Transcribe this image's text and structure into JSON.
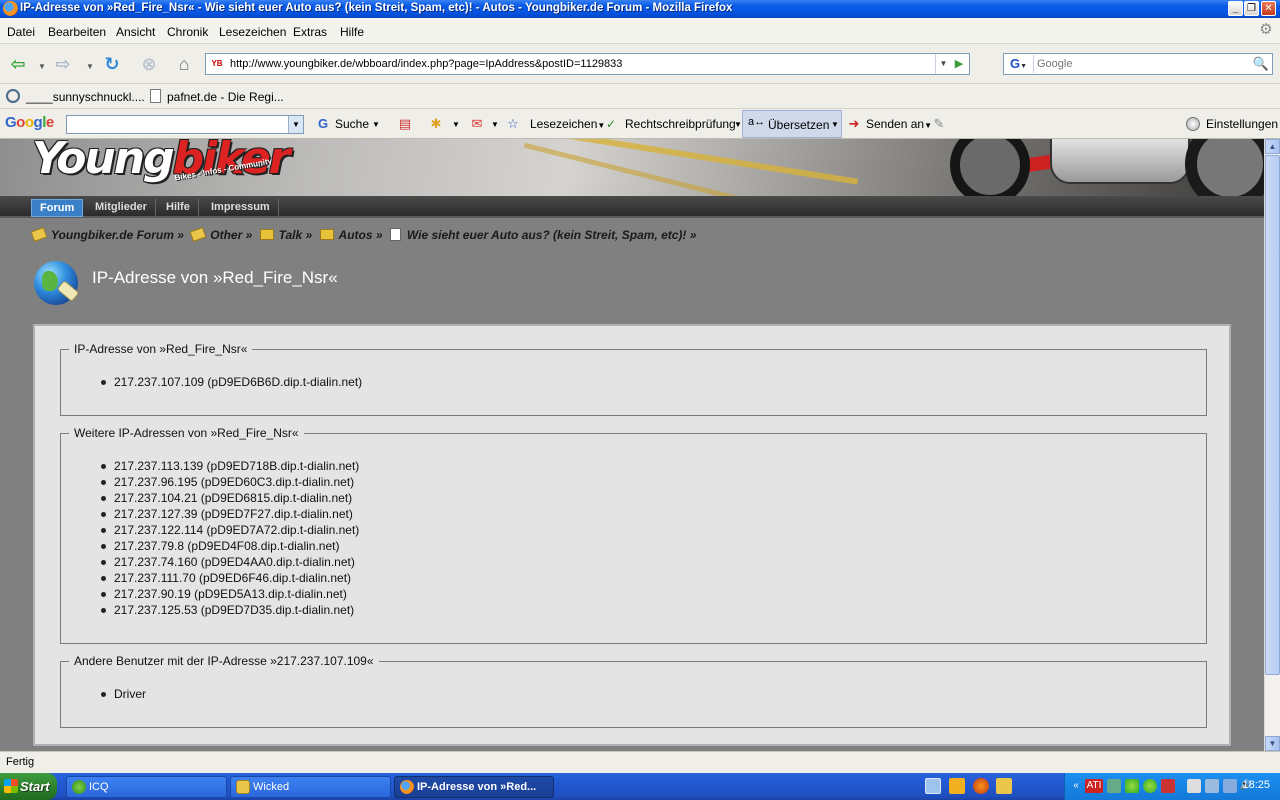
{
  "window": {
    "title": "IP-Adresse von »Red_Fire_Nsr« - Wie sieht euer Auto aus? (kein Streit, Spam, etc)! - Autos - Youngbiker.de Forum - Mozilla Firefox"
  },
  "menu": {
    "items": [
      "Datei",
      "Bearbeiten",
      "Ansicht",
      "Chronik",
      "Lesezeichen",
      "Extras",
      "Hilfe"
    ]
  },
  "navbar": {
    "url": "http://www.youngbiker.de/wbboard/index.php?page=IpAddress&postID=1129833",
    "search_value": "Google"
  },
  "bookmarks": {
    "items": [
      "____sunnyschnuckl....",
      "pafnet.de - Die Regi..."
    ]
  },
  "google_toolbar": {
    "logo": "Google",
    "search_label": "Suche",
    "bookmarks_label": "Lesezeichen",
    "spellcheck_label": "Rechtschreibprüfung",
    "translate_label": "Übersetzen",
    "send_label": "Senden an",
    "settings_label": "Einstellungen"
  },
  "site": {
    "logo_white": "Young",
    "logo_red": "biker",
    "slogan": "Bikes - Infos - Community",
    "tabs": [
      "Forum",
      "Mitglieder",
      "Hilfe",
      "Impressum"
    ]
  },
  "breadcrumb": [
    "Youngbiker.de Forum »",
    "Other »",
    "Talk »",
    "Autos »",
    "Wie sieht euer Auto aus? (kein Streit, Spam, etc)! »"
  ],
  "page": {
    "title": "IP-Adresse von »Red_Fire_Nsr«"
  },
  "sections": {
    "ip": {
      "legend": "IP-Adresse von »Red_Fire_Nsr«",
      "items": [
        "217.237.107.109 (pD9ED6B6D.dip.t-dialin.net)"
      ]
    },
    "other_ips": {
      "legend": "Weitere IP-Adressen von »Red_Fire_Nsr«",
      "items": [
        "217.237.113.139 (pD9ED718B.dip.t-dialin.net)",
        "217.237.96.195 (pD9ED60C3.dip.t-dialin.net)",
        "217.237.104.21 (pD9ED6815.dip.t-dialin.net)",
        "217.237.127.39 (pD9ED7F27.dip.t-dialin.net)",
        "217.237.122.114 (pD9ED7A72.dip.t-dialin.net)",
        "217.237.79.8 (pD9ED4F08.dip.t-dialin.net)",
        "217.237.74.160 (pD9ED4AA0.dip.t-dialin.net)",
        "217.237.111.70 (pD9ED6F46.dip.t-dialin.net)",
        "217.237.90.19 (pD9ED5A13.dip.t-dialin.net)",
        "217.237.125.53 (pD9ED7D35.dip.t-dialin.net)"
      ]
    },
    "other_users": {
      "legend": "Andere Benutzer mit der IP-Adresse »217.237.107.109«",
      "items": [
        "Driver"
      ]
    }
  },
  "status": {
    "text": "Fertig"
  },
  "taskbar": {
    "start_label": "Start",
    "items": [
      "ICQ",
      "Wicked",
      "IP-Adresse von »Red..."
    ],
    "clock": "18:25"
  }
}
